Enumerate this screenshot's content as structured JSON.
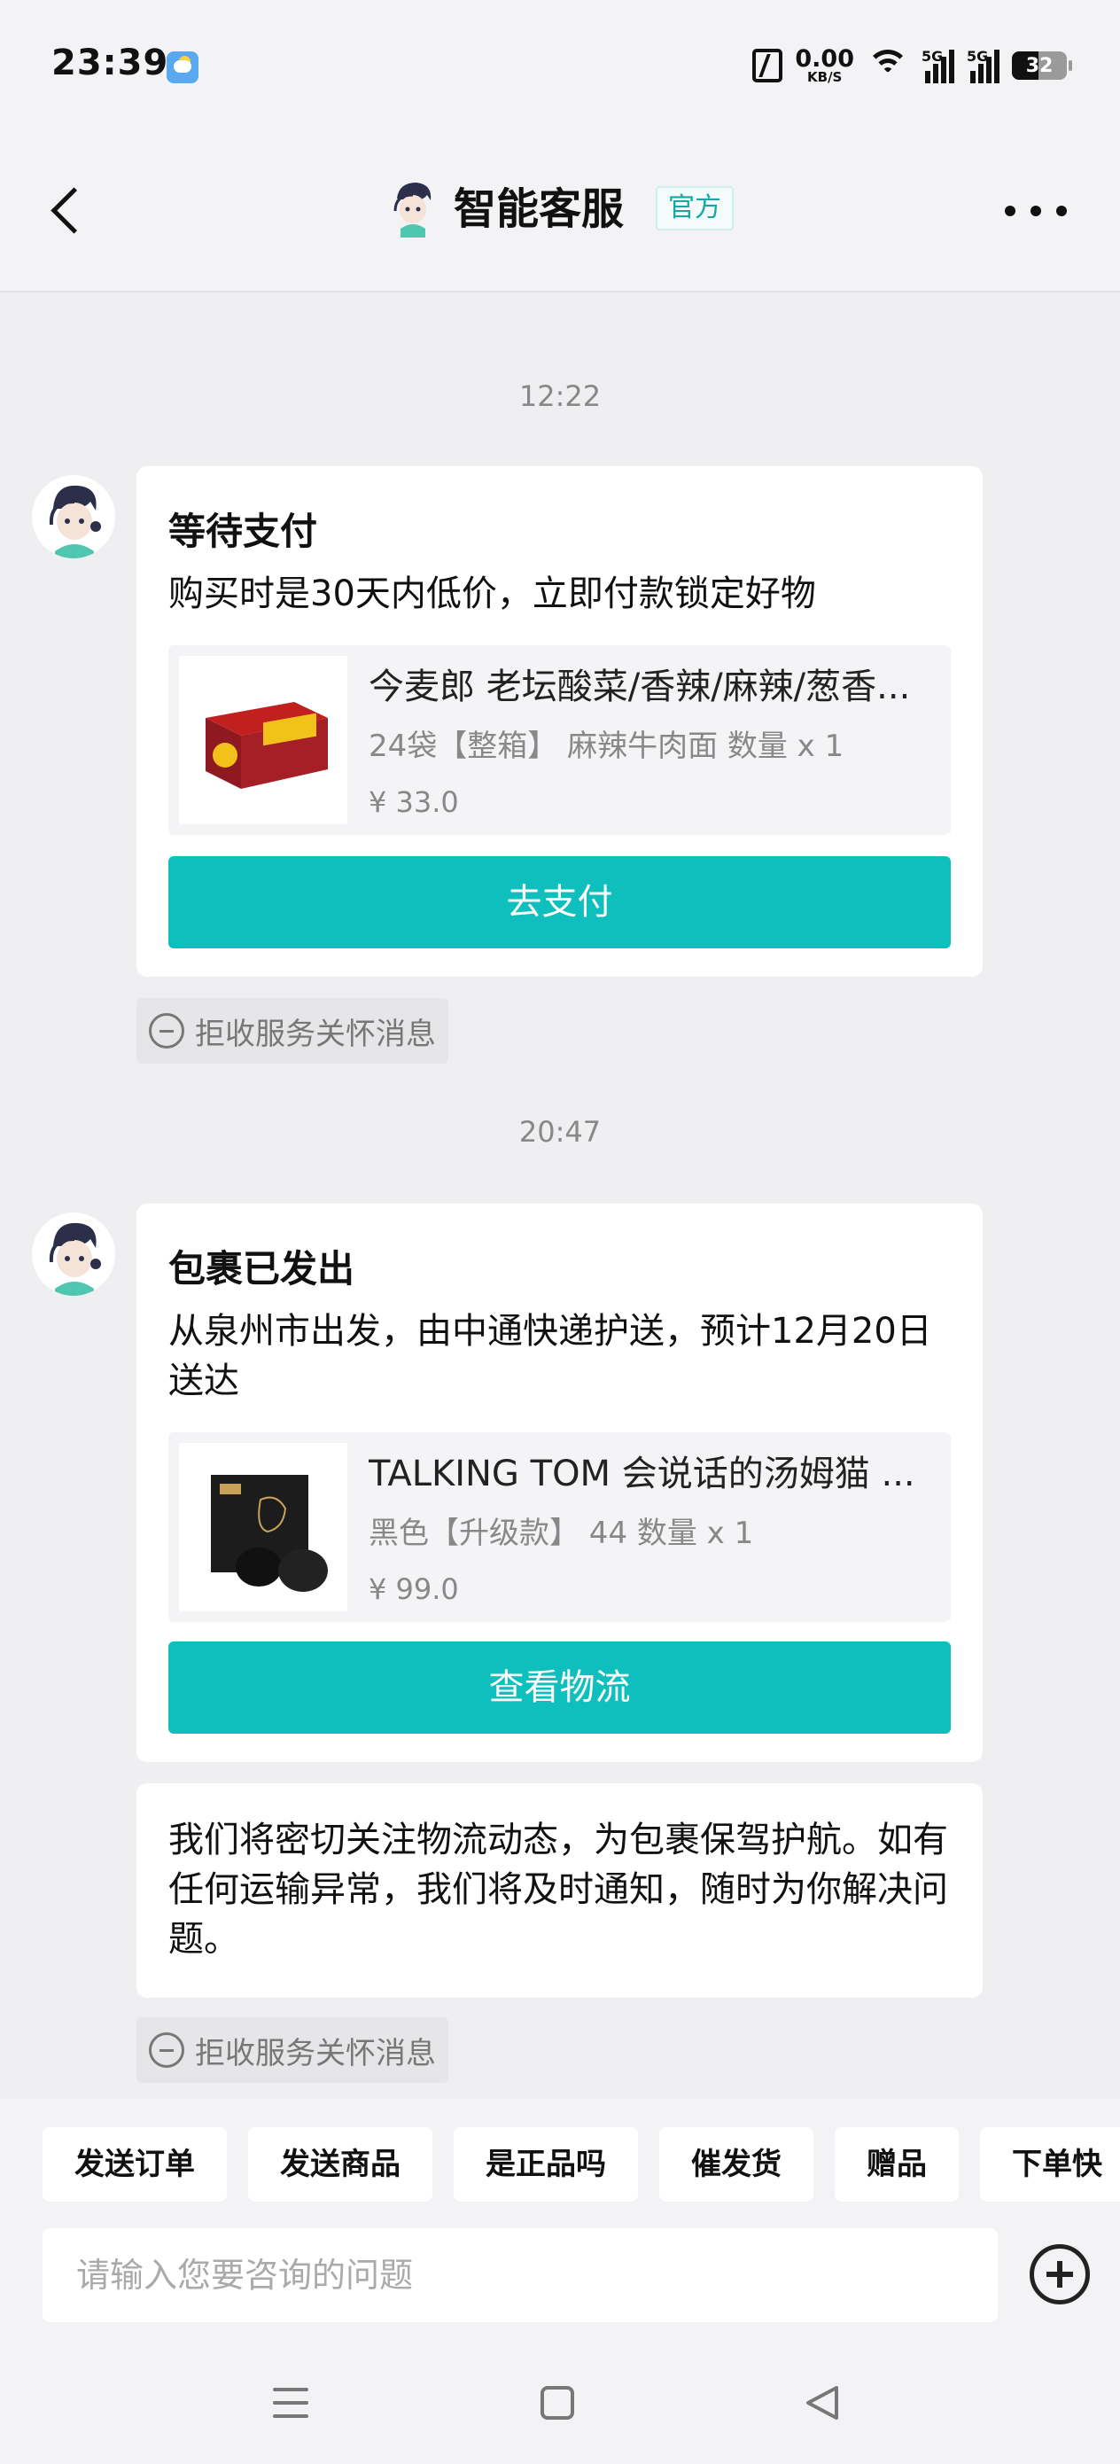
{
  "status_bar": {
    "time": "23:39",
    "net_speed": "0.00",
    "net_unit": "KB/S",
    "sim1": "5G",
    "sim2": "5G",
    "battery": "32"
  },
  "header": {
    "title": "智能客服",
    "badge": "官方"
  },
  "messages": [
    {
      "timestamp": "12:22",
      "card": {
        "title": "等待支付",
        "desc": "购买时是30天内低价，立即付款锁定好物",
        "product": {
          "name": "今麦郎 老坛酸菜/香辣/麻辣/葱香...",
          "spec": "24袋【整箱】 麻辣牛肉面  数量 x 1",
          "price": "¥ 33.0"
        },
        "button": "去支付"
      },
      "reject": "拒收服务关怀消息"
    },
    {
      "timestamp": "20:47",
      "card": {
        "title": "包裹已发出",
        "desc": "从泉州市出发，由中通快递护送，预计12月20日送达",
        "product": {
          "name": "TALKING TOM 会说话的汤姆猫 ...",
          "spec": "黑色【升级款】 44  数量 x 1",
          "price": "¥ 99.0"
        },
        "button": "查看物流"
      },
      "text": "我们将密切关注物流动态，为包裹保驾护航。如有任何运输异常，我们将及时通知，随时为你解决问题。",
      "reject": "拒收服务关怀消息"
    }
  ],
  "quick_replies": [
    "发送订单",
    "发送商品",
    "是正品吗",
    "催发货",
    "赠品",
    "下单快"
  ],
  "input": {
    "placeholder": "请输入您要咨询的问题"
  },
  "colors": {
    "accent": "#0fbfbd",
    "badge_text": "#18a7a5"
  }
}
